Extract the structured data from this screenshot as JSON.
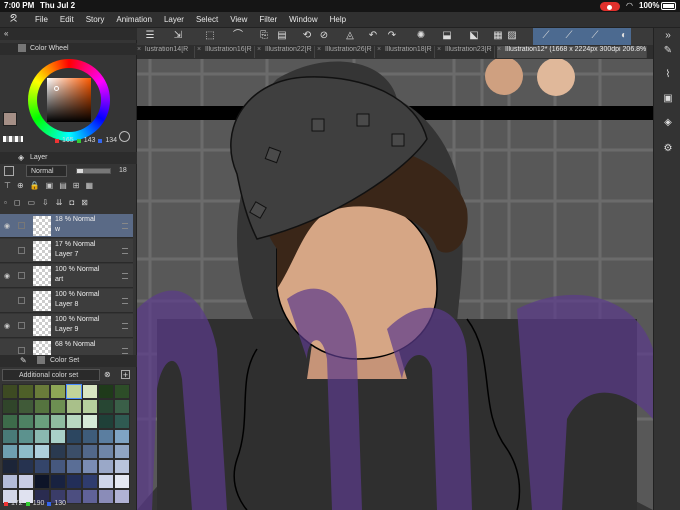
{
  "status": {
    "time": "7:00 PM",
    "date": "Thu Jul 2",
    "battery": "100%",
    "wifi_icon": "wifi-icon",
    "record_icon": "screen-record-icon"
  },
  "menu": {
    "logo_icon": "clip-studio-logo-icon",
    "items": [
      "File",
      "Edit",
      "Story",
      "Animation",
      "Layer",
      "Select",
      "View",
      "Filter",
      "Window",
      "Help"
    ]
  },
  "tabs": [
    {
      "label": "lustration14[R",
      "active": false
    },
    {
      "label": "Illustration16[R",
      "active": false
    },
    {
      "label": "Illustration22[R",
      "active": false
    },
    {
      "label": "Illustration26[R",
      "active": false
    },
    {
      "label": "Illustration18[R",
      "active": false
    },
    {
      "label": "Illustration23[R",
      "active": false
    },
    {
      "label": "Illustration12* (1668 x 2224px 300dpi 206.8%)",
      "active": true
    }
  ],
  "color_wheel": {
    "title": "Color Wheel",
    "rgb": {
      "r": "165",
      "g": "143",
      "b": "134"
    },
    "main_color": "#a58f86"
  },
  "layer_panel": {
    "title": "Layer",
    "blend_mode": "Normal",
    "opacity": "18",
    "layers": [
      {
        "mode": "18 % Normal",
        "name": "w",
        "selected": true,
        "visible": true,
        "thumb_icon": "purple-scribble-thumb"
      },
      {
        "mode": "17 % Normal",
        "name": "Layer 7",
        "selected": false,
        "visible": false,
        "thumb_icon": "colorful-figure-thumb"
      },
      {
        "mode": "100 % Normal",
        "name": "art",
        "selected": false,
        "visible": true,
        "thumb_icon": "folder-icon"
      },
      {
        "mode": "100 % Normal",
        "name": "Layer 8",
        "selected": false,
        "visible": false,
        "thumb_icon": "blank-thumb"
      },
      {
        "mode": "100 % Normal",
        "name": "Layer 9",
        "selected": false,
        "visible": true,
        "thumb_icon": "blank-thumb"
      },
      {
        "mode": "68 % Normal",
        "name": "",
        "selected": false,
        "visible": false,
        "thumb_icon": "blank-thumb"
      }
    ]
  },
  "color_set": {
    "title": "Color Set",
    "set_name": "Additional color set",
    "rgb": {
      "r": "172",
      "g": "190",
      "b": "130"
    },
    "swatches": [
      "#3d4a22",
      "#4e5f28",
      "#6a7c3a",
      "#8ea756",
      "#c2d49a",
      "#d9e6c2",
      "#1f3a1a",
      "#2d4d28",
      "#30452a",
      "#405a38",
      "#55743f",
      "#6d8f52",
      "#a9c08a",
      "#b6cf9e",
      "#274633",
      "#3a5f48",
      "#3d6b4a",
      "#4e8263",
      "#6aa07e",
      "#8fbca0",
      "#b8d8c0",
      "#d6ead8",
      "#1f4038",
      "#2f5a52",
      "#497a78",
      "#5c928e",
      "#8ab8b0",
      "#a9d0c8",
      "#2c4660",
      "#3e5c7a",
      "#5b7ea0",
      "#7fa4c4",
      "#6fa0b0",
      "#8dbcc8",
      "#aed0dc",
      "#2a3a50",
      "#3b4e68",
      "#52688a",
      "#6f86a8",
      "#90a6c4",
      "#1c2538",
      "#263350",
      "#34456a",
      "#46587e",
      "#5a6e96",
      "#7a8cb4",
      "#9aa8c8",
      "#b8c4dc",
      "#b4bcd8",
      "#c8cce4",
      "#0d1428",
      "#182240",
      "#222e58",
      "#2f3c6e",
      "#cfd6ea",
      "#e4e8f2",
      "#d2d6e8",
      "#e0e2f0",
      "#2a2c50",
      "#3a3c68",
      "#4c4e80",
      "#606298",
      "#8a8cb8",
      "#b0b2d4"
    ]
  },
  "canvas": {
    "bg_color": "#585858",
    "grid_color": "#6b6b6b",
    "skin_swatch_1": "#cfa080",
    "skin_swatch_2": "#e0b89a",
    "overlay_color": "#5b3a8c"
  },
  "icons": {
    "toolbar": [
      "menu-icon",
      "layer-move-icon",
      "select-icon",
      "lasso-icon",
      "copy-icon",
      "paste-icon",
      "transform-icon",
      "clear-icon",
      "fill-icon",
      "undo-icon",
      "redo-icon",
      "loading-icon",
      "crop-icon",
      "flip-icon",
      "grid-icon",
      "layer-color-icon",
      "ruler-icon",
      "snap-ruler-icon",
      "snap-special-icon",
      "stroke-icon"
    ],
    "right": [
      "pen-icon",
      "brush-icon",
      "gallery-icon",
      "layers-icon",
      "settings-icon"
    ]
  }
}
